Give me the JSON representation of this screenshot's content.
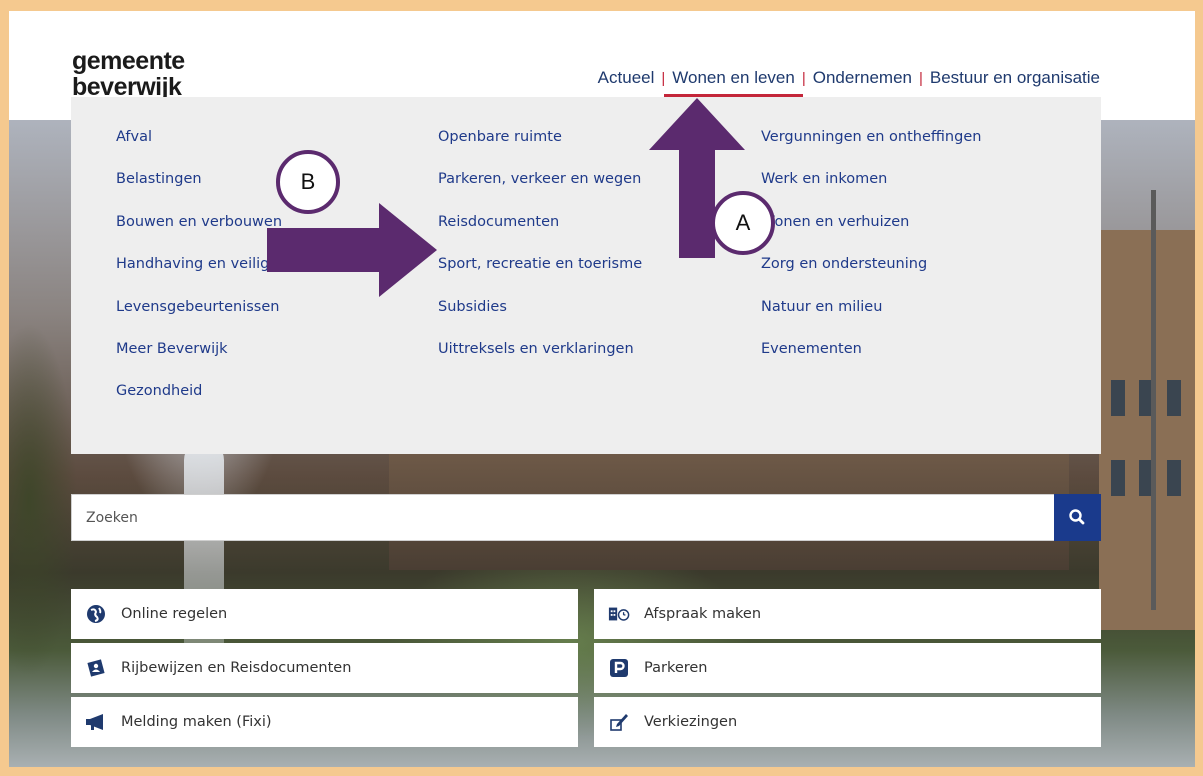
{
  "brand": {
    "line1": "gemeente",
    "line2": "beverwijk"
  },
  "nav": {
    "items": [
      {
        "label": "Actueel"
      },
      {
        "label": "Wonen en leven",
        "active": true
      },
      {
        "label": "Ondernemen"
      },
      {
        "label": "Bestuur en organisatie"
      }
    ],
    "separator": "|"
  },
  "menu": {
    "col1": [
      "Afval",
      "Belastingen",
      "Bouwen en verbouwen",
      "Handhaving en veiligheid",
      "Levensgebeurtenissen",
      "Meer Beverwijk",
      "Gezondheid"
    ],
    "col2": [
      "Openbare ruimte",
      "Parkeren, verkeer en wegen",
      "Reisdocumenten",
      "Sport, recreatie en toerisme",
      "Subsidies",
      "Uittreksels en verklaringen"
    ],
    "col3": [
      "Vergunningen en ontheffingen",
      "Werk en inkomen",
      "Wonen en verhuizen",
      "Zorg en ondersteuning",
      "Natuur en milieu",
      "Evenementen"
    ]
  },
  "annotations": {
    "a": "A",
    "b": "B",
    "color": "#5b2a6e"
  },
  "search": {
    "placeholder": "Zoeken",
    "icon": "search-icon"
  },
  "tiles": [
    {
      "label": "Online regelen",
      "icon": "globe-icon"
    },
    {
      "label": "Afspraak maken",
      "icon": "calendar-clock-icon"
    },
    {
      "label": "Rijbewijzen en Reisdocumenten",
      "icon": "id-card-icon"
    },
    {
      "label": "Parkeren",
      "icon": "parking-icon"
    },
    {
      "label": "Melding maken (Fixi)",
      "icon": "megaphone-icon"
    },
    {
      "label": "Verkiezingen",
      "icon": "ballot-pen-icon"
    }
  ],
  "colors": {
    "accent": "#c4263a",
    "nav_text": "#1f3a6e",
    "link": "#1f3a8a",
    "search_button": "#1a3a8c",
    "frame": "#f5c98f"
  }
}
